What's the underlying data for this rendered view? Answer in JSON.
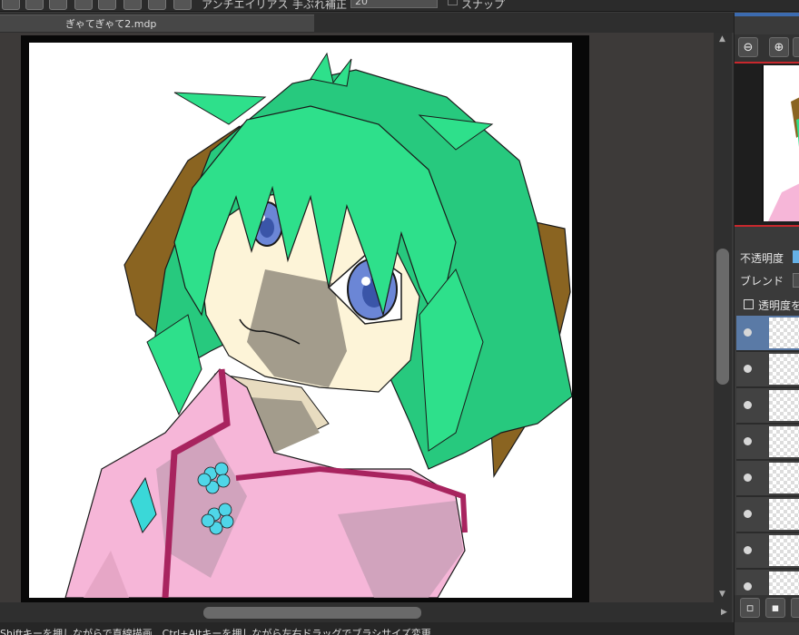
{
  "toolbar": {
    "antialias_label": "アンチエイリアス",
    "stabilizer_label": "手ぶれ補正",
    "stabilizer_value": "20",
    "snap_label": "スナップ"
  },
  "document_tab": {
    "title": "ぎゃてぎゃて2.mdp"
  },
  "status_bar": {
    "hint": "Shiftキーを押しながらで直線描画、Ctrl+Altキーを押しながら左右ドラッグでブラシサイズ変更"
  },
  "layer_panel": {
    "opacity_label": "不透明度",
    "blend_label": "ブレンド",
    "protect_alpha_label": "透明度を",
    "layers_count_visible": 8,
    "selected_layer_index": 0
  },
  "colors": {
    "hair": "#2ee08b",
    "ear": "#8a6421",
    "skin": "#fdf4d8",
    "eye": "#6b86d6",
    "kimono": "#f6b6d8",
    "accent_red": "#c8282d",
    "accent_blue": "#3c6bb0"
  },
  "icons": [
    "zoom-out-icon",
    "zoom-in-icon",
    "new-layer-icon",
    "duplicate-layer-icon",
    "visibility-eye-icon"
  ]
}
